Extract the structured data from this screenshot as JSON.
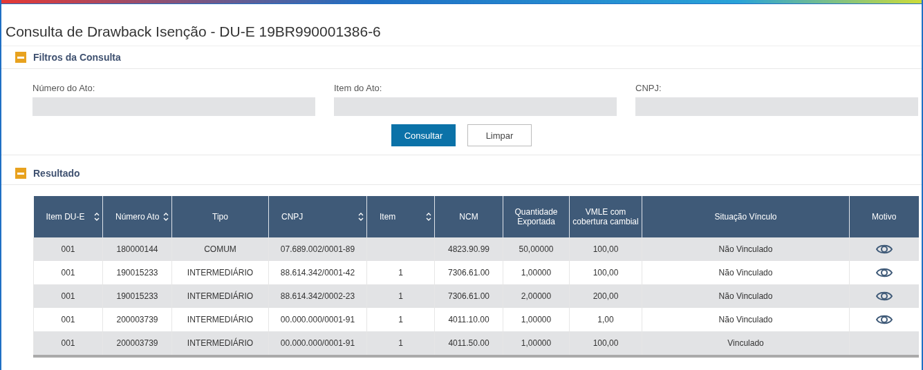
{
  "title": "Consulta de Drawback Isenção - DU-E 19BR990001386-6",
  "filters": {
    "heading": "Filtros da Consulta",
    "fields": [
      {
        "label": "Número do Ato:"
      },
      {
        "label": "Item do Ato:"
      },
      {
        "label": "CNPJ:"
      }
    ],
    "buttons": [
      {
        "label": "Consultar",
        "kind": "primary"
      },
      {
        "label": "Limpar",
        "kind": "secondary"
      }
    ]
  },
  "result": {
    "heading": "Resultado",
    "columns": [
      {
        "label": "Item DU-E",
        "sortable": true
      },
      {
        "label": "Número Ato",
        "sortable": true
      },
      {
        "label": "Tipo",
        "sortable": false
      },
      {
        "label": "CNPJ",
        "sortable": true
      },
      {
        "label": "Item",
        "sortable": true
      },
      {
        "label": "NCM",
        "sortable": false
      },
      {
        "label": "Quantidade Exportada",
        "sortable": false
      },
      {
        "label": "VMLE com cobertura cambial",
        "sortable": false
      },
      {
        "label": "Situação Vínculo",
        "sortable": false
      },
      {
        "label": "Motivo",
        "sortable": false
      }
    ],
    "rows": [
      {
        "cells": [
          "001",
          "180000144",
          "COMUM",
          "07.689.002/0001-89",
          "",
          "4823.90.99",
          "50,00000",
          "100,00",
          "Não Vinculado"
        ],
        "motivo": true
      },
      {
        "cells": [
          "001",
          "190015233",
          "INTERMEDIÁRIO",
          "88.614.342/0001-42",
          "1",
          "7306.61.00",
          "1,00000",
          "100,00",
          "Não Vinculado"
        ],
        "motivo": true
      },
      {
        "cells": [
          "001",
          "190015233",
          "INTERMEDIÁRIO",
          "88.614.342/0002-23",
          "1",
          "7306.61.00",
          "2,00000",
          "200,00",
          "Não Vinculado"
        ],
        "motivo": true
      },
      {
        "cells": [
          "001",
          "200003739",
          "INTERMEDIÁRIO",
          "00.000.000/0001-91",
          "1",
          "4011.10.00",
          "1,00000",
          "1,00",
          "Não Vinculado"
        ],
        "motivo": true
      },
      {
        "cells": [
          "001",
          "200003739",
          "INTERMEDIÁRIO",
          "00.000.000/0001-91",
          "1",
          "4011.50.00",
          "1,00000",
          "100,00",
          "Vinculado"
        ],
        "motivo": false
      }
    ]
  }
}
